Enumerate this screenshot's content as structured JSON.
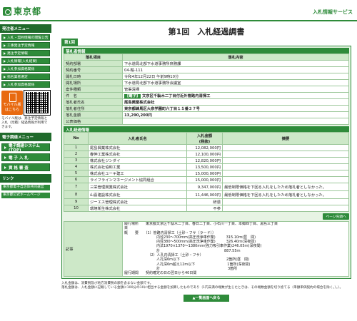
{
  "header": {
    "logo_text": "東京都",
    "service_name": "入札情報サービス"
  },
  "sidebar": {
    "menu_title": "発注者メニュー",
    "menu_items": [
      "入札・契約情報の閲覧公告",
      "工事発注予定情報",
      "発注予定情報",
      "入札情報(入札結果)",
      "入札参加資格関係",
      "指名業者選定",
      "入札参加資格関係"
    ],
    "mobile_label": "モバイル版\nはこちら",
    "mobile_note": "モバイル版は、発注予定情報と入札（見積）経過情報が利用できます。",
    "ds_title": "電子調達メニュー",
    "ds_items": [
      "電子調達システム(TOP)",
      "電 子 入 札",
      "資 格 審 査"
    ],
    "links_title": "リンク",
    "links": [
      "東京都電子自治体共同運営",
      "東京都公式ホームページ"
    ]
  },
  "main": {
    "page_title": "第1回　入札経過調書",
    "tab_label": "第1回",
    "section1_title": "落札者情報",
    "info_headers": [
      "落札項目",
      "落札内容"
    ],
    "info_rows": [
      {
        "label": "契約部署",
        "value": "下水道局北部下水道事務所庶務課"
      },
      {
        "label": "契約番号",
        "value": "04-輸-111"
      },
      {
        "label": "開札日時",
        "value": "令和4年12月22日 午前9時10分"
      },
      {
        "label": "開札場所",
        "value": "下水道局北部下水道事務所会議室"
      },
      {
        "label": "案件種類",
        "value": "管渠清掃"
      },
      {
        "label": "件　名",
        "stamp": "【電子】",
        "value": "文京区千駄木二丁目付近外管路内清掃工"
      },
      {
        "label": "落札者氏名",
        "value": "尾島興業株式会社"
      },
      {
        "label": "落札者住所",
        "value": "東京都練馬区大泉学園町六丁目１５番３７号"
      },
      {
        "label": "落札金額",
        "value": "13,290,200円"
      },
      {
        "label": "公表価格",
        "value": ""
      }
    ],
    "section2_title": "入札経過情報",
    "bid_headers": [
      "No",
      "入札者氏名",
      "入札金額\n(税抜)",
      "摘要"
    ],
    "bids": [
      {
        "no": "1",
        "name": "尾島興業株式会社",
        "amount": "12,082,000円",
        "note": ""
      },
      {
        "no": "2",
        "name": "春伸工業株式会社",
        "amount": "12,100,000円",
        "note": ""
      },
      {
        "no": "3",
        "name": "株式会社ジンダイ",
        "amount": "12,820,000円",
        "note": ""
      },
      {
        "no": "4",
        "name": "株式会社協和工業",
        "amount": "13,500,000円",
        "note": ""
      },
      {
        "no": "5",
        "name": "株式会社ユーキ建工",
        "amount": "15,000,000円",
        "note": ""
      },
      {
        "no": "6",
        "name": "ライフラインマネージメント協同組合",
        "amount": "15,000,000円",
        "note": ""
      },
      {
        "no": "7",
        "name": "三栄管理興業株式会社",
        "amount": "9,347,000円",
        "note": "最低制限価格を下回る入札をしたため落札者としなかった。"
      },
      {
        "no": "8",
        "name": "山喜建設株式会社",
        "amount": "11,446,000円",
        "note": "最低制限価格を下回る入札をしたため落札者としなかった。"
      },
      {
        "no": "9",
        "name": "ジーエス管理株式会社",
        "amount": "辞退",
        "note": ""
      },
      {
        "no": "10",
        "name": "環境衛生株式会社",
        "amount": "不参",
        "note": ""
      }
    ],
    "page_top_label": "ページ先頭へ",
    "remarks_label": "記事",
    "remarks_text": "履行場所　　東京都文京区千駄木二丁目、春日二丁目、小石川一丁目、本郷四丁目、湯島三丁目\n目\n概　　要　　（1）管路内清掃工（土砂・フサ（ラード））\n　　　　　　　　　内径230〜700mm(高圧洗浄車作業)　　　315.10ｍ(昼　間)\n　　　　　　　　　内径380〜500mm(高圧洗浄車作業)　　　326.40ｍ(深夜間)\n　　　　　　　　　内法1970×1370〜1380mm(強力吸引車作業)246.05ｍ(深夜間)\n　　　　　　　　　計　　　　　　　　　　　　　　　　　　887.55ｍ\n　　　　　　　（2）人孔内清掃工（土砂・フサ）\n　　　　　　　　　人孔深6m以下　　　　　　　　　　　　　2箇所(昼　間)\n　　　　　　　　　人孔深6m超え12m以下　　　　　　　　　1箇所(深夜間)\n　　　　　　　　　計　　　　　　　　　　　　　　　　　　　3箇所\n履行期間　　契約確定の日の翌日から40日間",
    "footer_note": "入札金額は、消費税及び地方消費税の額を含まない金額です。\n落札金額は、入札金額に記載している金額に100分の10に相当する金額を加算したものであり（1円未満の端数が生じたときは、その端数金額を切り捨てる（単額単価契約の場合を除く。）。）。",
    "back_label": "▲一覧画面へ戻る"
  }
}
